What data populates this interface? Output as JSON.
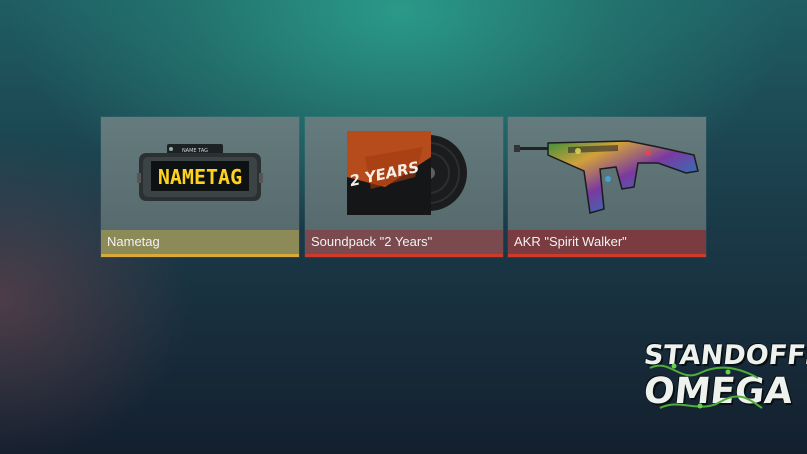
{
  "items": [
    {
      "name": "Nametag",
      "rarity_color": "#d9a93a",
      "label_bg": "#8c8a57",
      "icon": "nametag-icon",
      "art_text": "NAMETAG",
      "small_text": "NAME TAG"
    },
    {
      "name": "Soundpack \"2 Years\"",
      "rarity_color": "#cf3b2a",
      "label_bg": "#7a4a4e",
      "icon": "vinyl-record-icon",
      "art_text": "2 YEARS"
    },
    {
      "name": "AKR \"Spirit Walker\"",
      "rarity_color": "#cf3b2a",
      "label_bg": "#7a3c40",
      "icon": "rifle-icon"
    }
  ],
  "logo": {
    "line1": "STANDOFF:",
    "line2": "OMEGA"
  }
}
